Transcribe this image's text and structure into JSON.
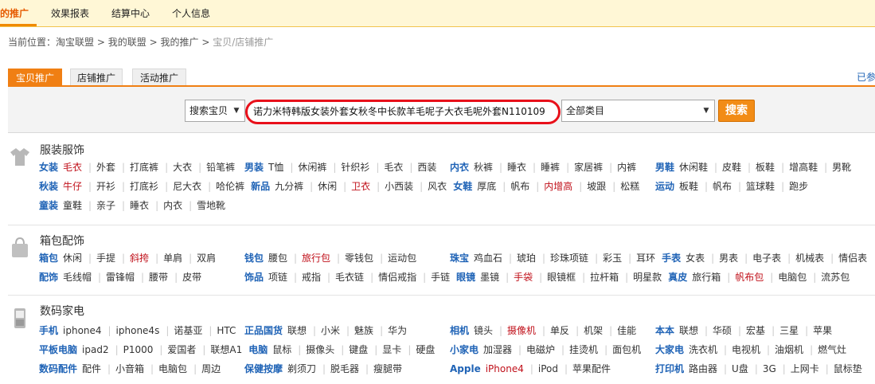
{
  "nav": {
    "items": [
      "的推广",
      "效果报表",
      "结算中心",
      "个人信息"
    ]
  },
  "breadcrumb": {
    "prefix": "当前位置：",
    "parts": [
      "淘宝联盟",
      "我的联盟",
      "我的推广"
    ],
    "last": "宝贝/店铺推广",
    "sep": ">"
  },
  "tabs": [
    "宝贝推广",
    "店铺推广",
    "活动推广"
  ],
  "already_text": "已参",
  "search": {
    "type_value": "搜索宝贝",
    "query": "诺力米特韩版女装外套女秋冬中长款羊毛呢子大衣毛呢外套N110109",
    "category_value": "全部类目",
    "button_label": "搜索"
  },
  "colors": {
    "accent": "#f07f13",
    "link": "#1f63b6",
    "highlight": "#c0101a"
  },
  "sections": [
    {
      "title": "服装服饰",
      "icon": "clothing-icon",
      "rows": [
        [
          "*女装",
          "!毛衣",
          "外套",
          "打底裤",
          "大衣",
          "铅笔裤",
          "*男装",
          "T恤",
          "休闲裤",
          "针织衫",
          "毛衣",
          "西装",
          "*内衣",
          "秋裤",
          "睡衣",
          "睡裤",
          "家居裤",
          "内裤",
          "*男鞋",
          "休闲鞋",
          "皮鞋",
          "板鞋",
          "增高鞋",
          "男靴"
        ],
        [
          "*秋装",
          "!牛仔",
          "开衫",
          "打底衫",
          "尼大衣",
          "哈伦裤",
          "*新品",
          "九分裤",
          "休闲",
          "!卫衣",
          "小西装",
          "风衣",
          "*女鞋",
          "厚底",
          "帆布",
          "!内增高",
          "坡跟",
          "松糕",
          "*运动",
          "板鞋",
          "帆布",
          "篮球鞋",
          "跑步"
        ],
        [
          "*童装",
          "童鞋",
          "亲子",
          "睡衣",
          "内衣",
          "雪地靴"
        ]
      ]
    },
    {
      "title": "箱包配饰",
      "icon": "bag-icon",
      "rows": [
        [
          "*箱包",
          "休闲",
          "手提",
          "!斜挎",
          "单肩",
          "双肩",
          "*钱包",
          "腰包",
          "!旅行包",
          "零钱包",
          "运动包",
          "*珠宝",
          "鸡血石",
          "琥珀",
          "珍珠项链",
          "彩玉",
          "耳环",
          "*手表",
          "女表",
          "男表",
          "电子表",
          "机械表",
          "情侣表"
        ],
        [
          "*配饰",
          "毛线帽",
          "雷锋帽",
          "腰带",
          "皮带",
          "*饰品",
          "项链",
          "戒指",
          "毛衣链",
          "情侣戒指",
          "手链",
          "*眼镜",
          "墨镜",
          "!手袋",
          "眼镜框",
          "拉杆箱",
          "明星款",
          "*真皮",
          "旅行箱",
          "!帆布包",
          "电脑包",
          "流苏包"
        ]
      ]
    },
    {
      "title": "数码家电",
      "icon": "phone-icon",
      "rows": [
        [
          "*手机",
          "iphone4",
          "iphone4s",
          "诺基亚",
          "HTC",
          "*正品国货",
          "联想",
          "小米",
          "魅族",
          "华为",
          "*相机",
          "镜头",
          "!摄像机",
          "单反",
          "机架",
          "佳能",
          "*本本",
          "联想",
          "华硕",
          "宏基",
          "三星",
          "苹果"
        ],
        [
          "*平板电脑",
          "ipad2",
          "P1000",
          "爱国者",
          "联想A1",
          "*电脑",
          "鼠标",
          "摄像头",
          "键盘",
          "显卡",
          "硬盘",
          "*小家电",
          "加湿器",
          "电磁炉",
          "挂烫机",
          "面包机",
          "*大家电",
          "洗衣机",
          "电视机",
          "油烟机",
          "燃气灶"
        ],
        [
          "*数码配件",
          "配件",
          "小音箱",
          "电脑包",
          "周边",
          "*保健按摩",
          "剃须刀",
          "脱毛器",
          "瘦腿带",
          "*Apple",
          "!iPhone4",
          "iPod",
          "苹果配件",
          "*打印机",
          "路由器",
          "U盘",
          "3G",
          "上网卡",
          "鼠标垫"
        ]
      ]
    }
  ]
}
